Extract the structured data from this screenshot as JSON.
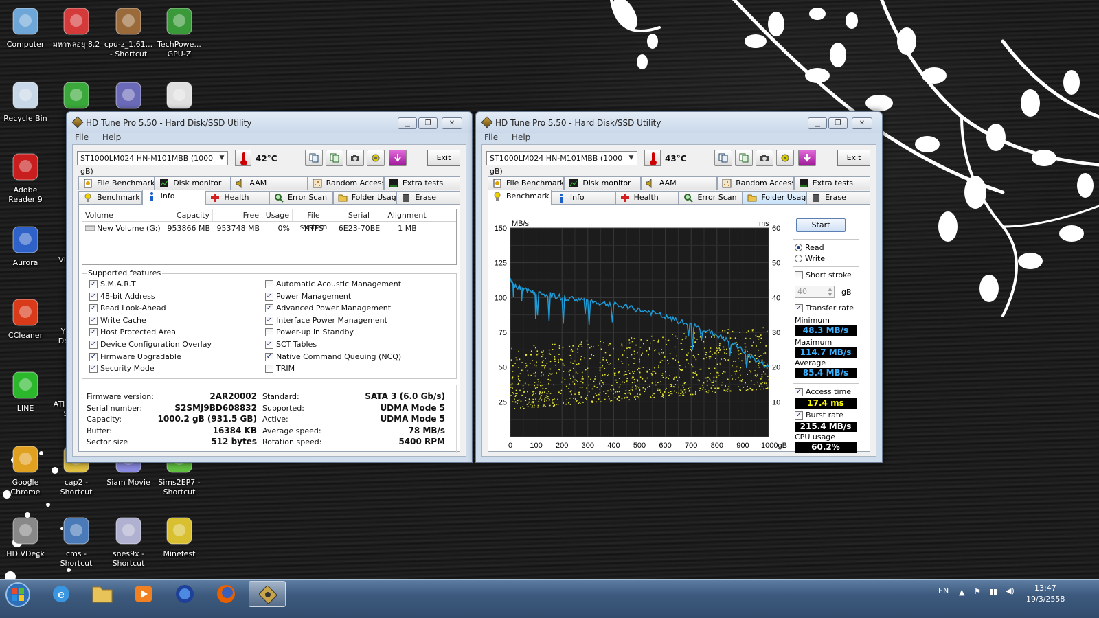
{
  "desktop": {
    "icons": [
      {
        "label": "Computer",
        "icon": "computer-icon"
      },
      {
        "label": "มหาพลอยุ 8.2",
        "icon": "app-logo-icon"
      },
      {
        "label": "cpu-z_1.61... - Shortcut",
        "icon": "books-icon"
      },
      {
        "label": "TechPowe... GPU-Z",
        "icon": "gpu-card-icon"
      },
      {
        "label": "Recycle Bin",
        "icon": "recycle-bin-icon"
      },
      {
        "label": "",
        "icon": "green-disc-icon"
      },
      {
        "label": "",
        "icon": "castle-icon"
      },
      {
        "label": "",
        "icon": "hex-magnifier-icon"
      },
      {
        "label": "Adobe Reader 9",
        "icon": "pdf-icon"
      },
      {
        "label": "Aurora",
        "icon": "firefox-blue-icon"
      },
      {
        "label": "CCleaner",
        "icon": "ccleaner-icon"
      },
      {
        "label": "LINE",
        "icon": "line-icon"
      },
      {
        "label": "Google Chrome",
        "icon": "chrome-icon"
      },
      {
        "label": "cap2 - Shortcut",
        "icon": "folder-icon"
      },
      {
        "label": "Siam Movie",
        "icon": "movie-icon"
      },
      {
        "label": "Sims2EP7 - Shortcut",
        "icon": "sims-icon"
      },
      {
        "label": "HD VDeck",
        "icon": "disc-icon"
      },
      {
        "label": "cms - Shortcut",
        "icon": "car-icon"
      },
      {
        "label": "snes9x - Shortcut",
        "icon": "controller-icon"
      },
      {
        "label": "Minefest",
        "icon": "sponge-block-icon"
      }
    ],
    "partial_labels": [
      "VL",
      "Y",
      "Dc",
      "ATI",
      "S"
    ]
  },
  "window_common": {
    "title": "HD Tune Pro 5.50 - Hard Disk/SSD Utility",
    "menu": [
      "File",
      "Help"
    ],
    "drive": "ST1000LM024 HN-M101MBB (1000 gB)",
    "exit_label": "Exit",
    "tabs_top": [
      "File Benchmark",
      "Disk monitor",
      "AAM",
      "Random Access",
      "Extra tests"
    ],
    "tabs_bottom": [
      "Benchmark",
      "Info",
      "Health",
      "Error Scan",
      "Folder Usage",
      "Erase"
    ]
  },
  "left_window": {
    "temperature": "42°C",
    "active_tab": "Info",
    "volume_columns": [
      "Volume",
      "Capacity",
      "Free",
      "Usage",
      "File system",
      "Serial",
      "Alignment"
    ],
    "volumes": [
      [
        "New Volume (G:)",
        "953866 MB",
        "953748 MB",
        "0%",
        "NTFS",
        "6E23-70BE",
        "1 MB"
      ]
    ],
    "supported_features_label": "Supported features",
    "features_left": [
      {
        "label": "S.M.A.R.T",
        "checked": true
      },
      {
        "label": "48-bit Address",
        "checked": true
      },
      {
        "label": "Read Look-Ahead",
        "checked": true
      },
      {
        "label": "Write Cache",
        "checked": true
      },
      {
        "label": "Host Protected Area",
        "checked": true
      },
      {
        "label": "Device Configuration Overlay",
        "checked": true
      },
      {
        "label": "Firmware Upgradable",
        "checked": true
      },
      {
        "label": "Security Mode",
        "checked": true
      }
    ],
    "features_right": [
      {
        "label": "Automatic Acoustic Management",
        "checked": false
      },
      {
        "label": "Power Management",
        "checked": true
      },
      {
        "label": "Advanced Power Management",
        "checked": true
      },
      {
        "label": "Interface Power Management",
        "checked": true
      },
      {
        "label": "Power-up in Standby",
        "checked": false
      },
      {
        "label": "SCT Tables",
        "checked": true
      },
      {
        "label": "Native Command Queuing (NCQ)",
        "checked": true
      },
      {
        "label": "TRIM",
        "checked": false
      }
    ],
    "details_left": [
      {
        "key": "Firmware version:",
        "value": "2AR20002"
      },
      {
        "key": "Serial number:",
        "value": "S2SMJ9BD608832"
      },
      {
        "key": "Capacity:",
        "value": "1000.2 gB (931.5 GB)"
      },
      {
        "key": "Buffer:",
        "value": "16384 KB"
      },
      {
        "key": "Sector size",
        "value": "512 bytes"
      }
    ],
    "details_right": [
      {
        "key": "Standard:",
        "value": "SATA 3 (6.0 Gb/s)"
      },
      {
        "key": "Supported:",
        "value": "UDMA Mode 5"
      },
      {
        "key": "Active:",
        "value": "UDMA Mode 5"
      },
      {
        "key": "Average speed:",
        "value": "78 MB/s"
      },
      {
        "key": "Rotation speed:",
        "value": "5400 RPM"
      }
    ]
  },
  "right_window": {
    "temperature": "43°C",
    "active_tab": "Benchmark",
    "start_label": "Start",
    "read_label": "Read",
    "write_label": "Write",
    "short_stroke_label": "Short stroke",
    "short_stroke_value": "40",
    "short_stroke_unit": "gB",
    "transfer_rate_label": "Transfer rate",
    "minimum_label": "Minimum",
    "minimum_value": "48.3 MB/s",
    "maximum_label": "Maximum",
    "maximum_value": "114.7 MB/s",
    "average_label": "Average",
    "average_value": "85.4 MB/s",
    "access_time_label": "Access time",
    "access_time_value": "17.4 ms",
    "burst_rate_label": "Burst rate",
    "burst_rate_value": "215.4 MB/s",
    "cpu_usage_label": "CPU usage",
    "cpu_usage_value": "60.2%",
    "colors": {
      "transfer": "#1e9ad6",
      "access": "#e8e830",
      "min": "#3ab0ff",
      "max": "#3ab0ff",
      "avg": "#3ab0ff",
      "access_text": "#ffff00",
      "burst": "#ffffff",
      "cpu": "#ffffff"
    }
  },
  "chart_data": {
    "type": "line",
    "title": "",
    "xlabel": "",
    "ylabel": "MB/s",
    "y2label": "ms",
    "xlim": [
      0,
      1000
    ],
    "ylim": [
      0,
      150
    ],
    "y2lim": [
      0,
      60
    ],
    "x_ticks": [
      "0",
      "100",
      "200",
      "300",
      "400",
      "500",
      "600",
      "700",
      "800",
      "900",
      "1000gB"
    ],
    "y_ticks": [
      "25",
      "50",
      "75",
      "100",
      "125",
      "150"
    ],
    "y2_ticks": [
      "10",
      "20",
      "30",
      "40",
      "50",
      "60"
    ],
    "grid": true,
    "series": [
      {
        "name": "Transfer rate",
        "axis": "left",
        "x": [
          0,
          20,
          50,
          80,
          100,
          150,
          200,
          250,
          300,
          350,
          400,
          450,
          500,
          550,
          600,
          650,
          700,
          750,
          800,
          850,
          900,
          950,
          1000
        ],
        "y": [
          112,
          108,
          106,
          104,
          103,
          102,
          100,
          99,
          98,
          96,
          95,
          93,
          91,
          89,
          86,
          83,
          80,
          77,
          73,
          68,
          62,
          55,
          50
        ]
      },
      {
        "name": "Access time",
        "axis": "right",
        "type": "scatter",
        "range_ms": [
          8,
          30
        ]
      }
    ]
  },
  "taskbar": {
    "language": "EN",
    "time": "13:47",
    "date": "19/3/2558",
    "pinned": [
      "start-orb-icon",
      "internet-explorer-icon",
      "explorer-folder-icon",
      "media-player-icon",
      "aurora-icon",
      "firefox-icon",
      "hdtune-icon"
    ]
  }
}
